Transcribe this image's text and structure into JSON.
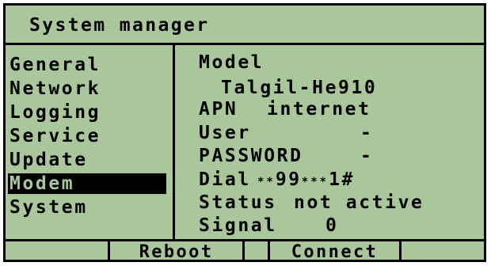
{
  "title": "System manager",
  "menu": {
    "items": [
      {
        "label": "General",
        "selected": false
      },
      {
        "label": "Network",
        "selected": false
      },
      {
        "label": "Logging",
        "selected": false
      },
      {
        "label": "Service",
        "selected": false
      },
      {
        "label": "Update",
        "selected": false
      },
      {
        "label": "Modem",
        "selected": true
      },
      {
        "label": "System",
        "selected": false
      }
    ]
  },
  "details": {
    "model_label": "Model",
    "model_value": "Talgil-He910",
    "apn_label": "APN",
    "apn_value": "internet",
    "user_label": "User",
    "user_value": "-",
    "password_label": "PASSWORD",
    "password_value": "-",
    "dial_label": "Dial",
    "dial_value_stars1": "**",
    "dial_value_99": "99",
    "dial_value_stars2": "***",
    "dial_value_end": "1#",
    "status_label": "Status",
    "status_value": "not active",
    "signal_label": "Signal",
    "signal_value": "0"
  },
  "softkeys": {
    "reboot": "Reboot",
    "connect": "Connect"
  },
  "colors": {
    "lcd_background": "#a9c79b",
    "foreground": "#000000"
  }
}
